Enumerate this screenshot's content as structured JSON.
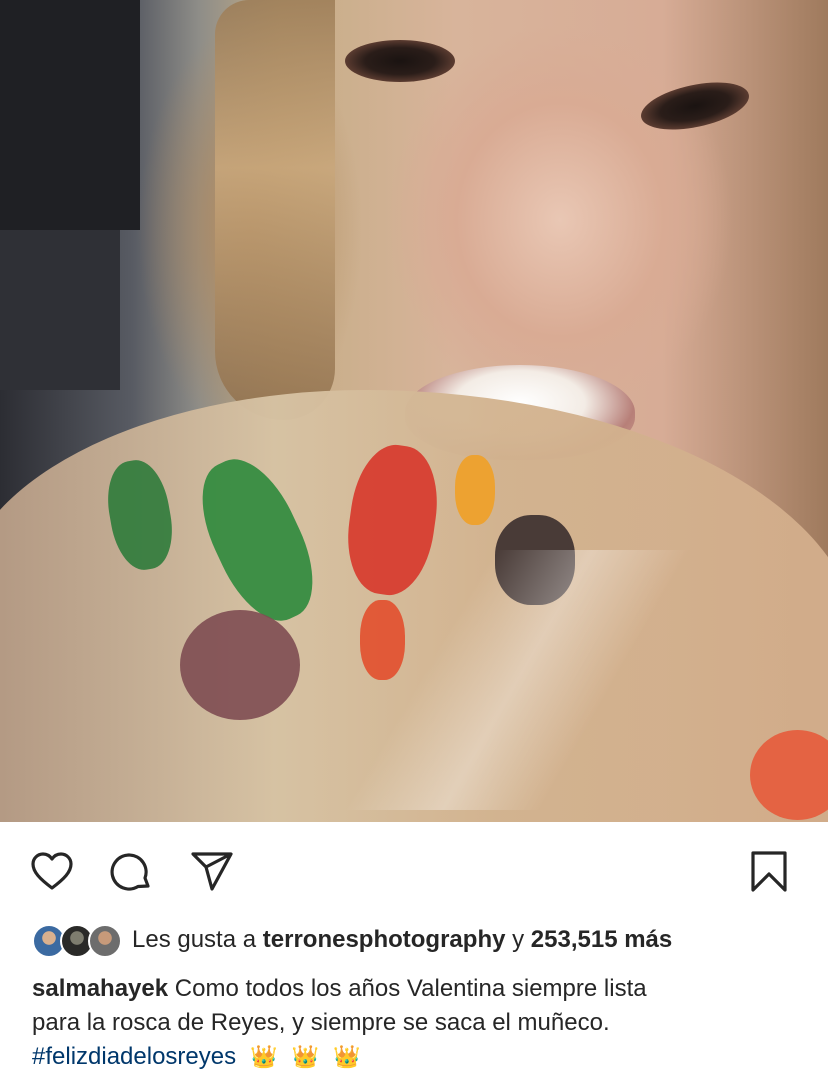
{
  "post": {
    "media_alt": "",
    "actions": {
      "like_icon": "heart-outline-icon",
      "comment_icon": "comment-bubble-icon",
      "share_icon": "paper-plane-icon",
      "save_icon": "bookmark-outline-icon"
    },
    "likes": {
      "prefix": "Les gusta a",
      "liked_by_user": "terronesphotography",
      "connector": "y",
      "count_text": "253,515 más"
    },
    "caption": {
      "username": "salmahayek",
      "text_line1": "Como todos los años Valentina siempre lista",
      "text_line2": "para la rosca de Reyes, y siempre se saca el muñeco.",
      "hashtag": "#felizdiadelosreyes",
      "emoji": [
        "👑",
        "👑",
        "👑"
      ]
    }
  }
}
